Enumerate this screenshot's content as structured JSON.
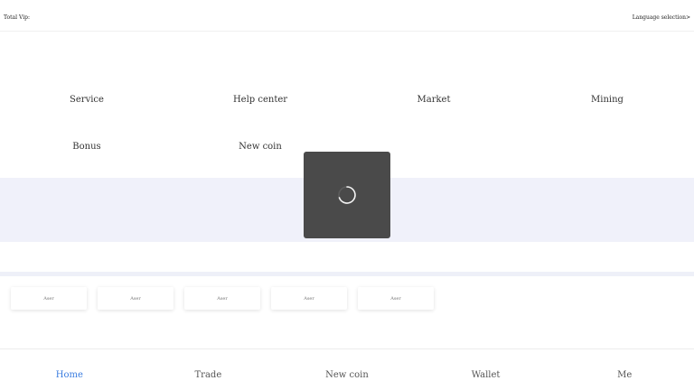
{
  "header": {
    "total_vip": "Total Vip:",
    "language_selection": "Language selection>"
  },
  "menu": {
    "items": [
      {
        "label": "Service"
      },
      {
        "label": "Help center"
      },
      {
        "label": "Market"
      },
      {
        "label": "Mining"
      },
      {
        "label": "Bonus"
      },
      {
        "label": "New coin"
      }
    ]
  },
  "cards": {
    "items": [
      {
        "label": "Aser"
      },
      {
        "label": "Aser"
      },
      {
        "label": "Aser"
      },
      {
        "label": "Aser"
      },
      {
        "label": "Aser"
      }
    ]
  },
  "tabbar": {
    "items": [
      {
        "label": "Home",
        "active": true
      },
      {
        "label": "Trade"
      },
      {
        "label": "New coin"
      },
      {
        "label": "Wallet"
      },
      {
        "label": "Me"
      }
    ]
  },
  "colors": {
    "accent": "#3b7de0",
    "banner_bg": "#f0f1fa",
    "loading_bg": "#4a4a4a"
  },
  "icons": {
    "loading": "loading-spinner-icon"
  }
}
